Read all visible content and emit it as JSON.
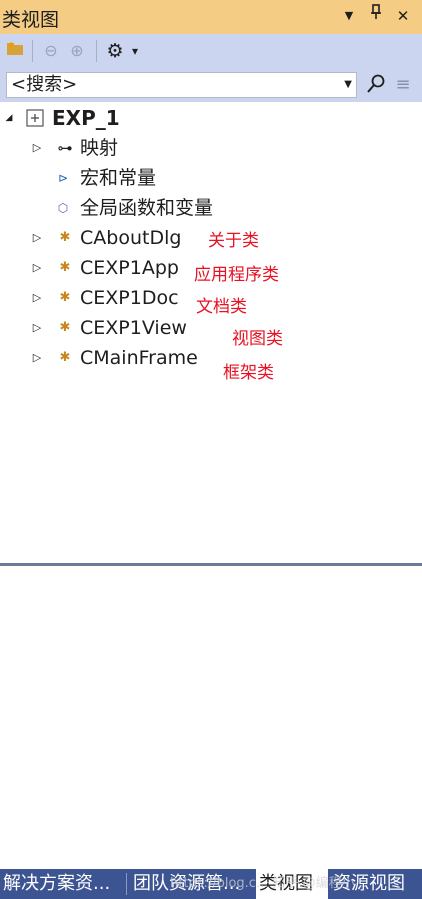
{
  "titlebar": {
    "title": "类视图",
    "dropdown_glyph": "▼",
    "pin_glyph": "📌",
    "close_glyph": "✕"
  },
  "toolbar": {
    "new_folder_glyph": "📁",
    "back_glyph": "⊖",
    "forward_glyph": "⊕",
    "settings_glyph": "⚙",
    "settings_dropdown_glyph": "▾"
  },
  "search": {
    "value": "<搜索>",
    "search_glyph": "⚲",
    "options_glyph": "≡"
  },
  "tree": {
    "root": {
      "label": "EXP_1",
      "expander": "◢"
    },
    "items": [
      {
        "label": "映射",
        "expander": "▷",
        "icon": "⊶"
      },
      {
        "label": "宏和常量",
        "expander": "",
        "icon": "⊳"
      },
      {
        "label": "全局函数和变量",
        "expander": "",
        "icon": "⬡"
      },
      {
        "label": "CAboutDlg",
        "expander": "▷",
        "icon": "✱",
        "annotation": "关于类"
      },
      {
        "label": "CEXP1App",
        "expander": "▷",
        "icon": "✱",
        "annotation": "应用程序类"
      },
      {
        "label": "CEXP1Doc",
        "expander": "▷",
        "icon": "✱",
        "annotation": "文档类"
      },
      {
        "label": "CEXP1View",
        "expander": "▷",
        "icon": "✱",
        "annotation": "视图类"
      },
      {
        "label": "CMainFrame",
        "expander": "▷",
        "icon": "✱",
        "annotation": "框架类"
      }
    ]
  },
  "tabs": [
    {
      "label": "解决方案资..."
    },
    {
      "label": "团队资源管..."
    },
    {
      "label": "类视图"
    },
    {
      "label": "资源视图"
    }
  ],
  "watermark": "https://blog.c... 知乎 @编程小..."
}
